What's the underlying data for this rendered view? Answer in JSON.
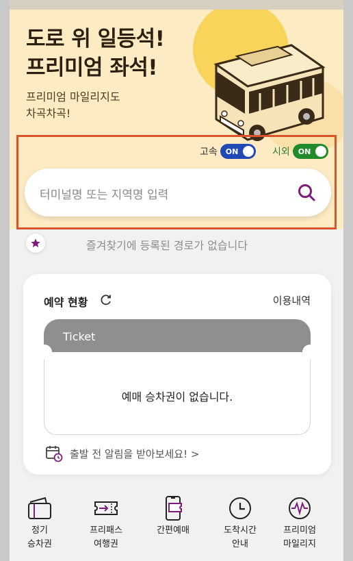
{
  "banner": {
    "headline_line1": "도로 위 일등석!",
    "headline_line2": "프리미엄 좌석!",
    "sub_line1": "프리미엄 마일리지도",
    "sub_line2": "차곡차곡!"
  },
  "toggles": {
    "express": {
      "label": "고속",
      "state": "ON"
    },
    "intercity": {
      "label": "시외",
      "state": "ON"
    }
  },
  "search": {
    "placeholder": "터미널명 또는 지역명 입력",
    "icon": "search-icon"
  },
  "favorites": {
    "empty_text": "즐겨찾기에 등록된 경로가 없습니다"
  },
  "reservation": {
    "title": "예약 현황",
    "history_link": "이용내역",
    "ticket_label": "Ticket",
    "empty_text": "예매 승차권이 없습니다.",
    "alert_text": "출발 전 알림을 받아보세요! >"
  },
  "nav": [
    {
      "label": "정기\n승차권",
      "icon": "commuter-pass-icon"
    },
    {
      "label": "프리패스\n여행권",
      "icon": "free-pass-icon"
    },
    {
      "label": "간편예매",
      "icon": "quick-booking-icon"
    },
    {
      "label": "도착시간\n안내",
      "icon": "clock-icon"
    },
    {
      "label": "프리미엄\n마일리지",
      "icon": "mileage-icon"
    }
  ],
  "colors": {
    "banner_bg": "#fdebc3",
    "highlight_border": "#d9532b",
    "toggle_express": "#2249b3",
    "toggle_intercity": "#218a2b",
    "accent_purple": "#7b1e7a"
  }
}
